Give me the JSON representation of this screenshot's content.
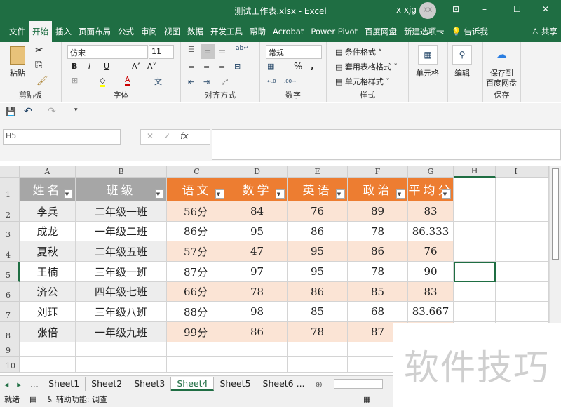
{
  "title": {
    "text": "测试工作表.xlsx  -  Excel",
    "user": "x xjg",
    "avatar": "XX",
    "ribbon_display": "⊡",
    "minimize": "–",
    "maximize": "☐",
    "close": "✕"
  },
  "menu": [
    "文件",
    "开始",
    "插入",
    "页面布局",
    "公式",
    "审阅",
    "视图",
    "数据",
    "开发工具",
    "帮助",
    "Acrobat",
    "Power Pivot",
    "百度网盘",
    "新建选项卡",
    "💡 告诉我",
    "♙ 共享"
  ],
  "menu_active": 1,
  "ribbon": {
    "clipboard": {
      "label": "剪贴板",
      "paste": "粘贴"
    },
    "font": {
      "label": "字体",
      "name": "仿宋",
      "size": "11",
      "bold": "B",
      "italic": "I",
      "underline": "U",
      "grow": "A˄",
      "shrink": "A˅",
      "color": "A",
      "fill": "◇",
      "wen": "文"
    },
    "align": {
      "label": "对齐方式",
      "wrap": "ab↵"
    },
    "number": {
      "label": "数字",
      "format": "常规",
      "pct": "%",
      "comma": ",",
      "inc": "←.0",
      "dec": ".00→"
    },
    "styles": {
      "label": "样式",
      "cond": "条件格式 ˅",
      "table": "套用表格格式 ˅",
      "cell": "单元格样式 ˅"
    },
    "cells": {
      "label": "单元格"
    },
    "edit": {
      "label": "编辑"
    },
    "save": {
      "label": "保存",
      "btn1": "保存到",
      "btn2": "百度网盘"
    }
  },
  "namebox": "H5",
  "fx": "fx",
  "columns": [
    "A",
    "B",
    "C",
    "D",
    "E",
    "F",
    "G",
    "H",
    "I"
  ],
  "rows": [
    "1",
    "2",
    "3",
    "4",
    "5",
    "6",
    "7",
    "8",
    "9",
    "10"
  ],
  "table": {
    "headers": [
      "姓名",
      "班级",
      "语文",
      "数学",
      "英语",
      "政治",
      "平均分"
    ],
    "data": [
      [
        "李兵",
        "二年级一班",
        "56分",
        "84",
        "76",
        "89",
        "83"
      ],
      [
        "成龙",
        "一年级二班",
        "86分",
        "95",
        "86",
        "78",
        "86.333"
      ],
      [
        "夏秋",
        "二年级五班",
        "57分",
        "47",
        "95",
        "86",
        "76"
      ],
      [
        "王楠",
        "三年级一班",
        "87分",
        "97",
        "95",
        "78",
        "90"
      ],
      [
        "济公",
        "四年级七班",
        "66分",
        "78",
        "86",
        "85",
        "83"
      ],
      [
        "刘珏",
        "三年级八班",
        "88分",
        "98",
        "85",
        "68",
        "83.667"
      ],
      [
        "张倍",
        "一年级九班",
        "99分",
        "86",
        "78",
        "87",
        ""
      ]
    ]
  },
  "colors": {
    "green": "#1f6e43",
    "gray_header": "#a6a6a6",
    "orange_header": "#ed7d31",
    "gray_band": "#ededed",
    "orange_band": "#fbe4d5"
  },
  "sheets": [
    "Sheet1",
    "Sheet2",
    "Sheet3",
    "Sheet4",
    "Sheet5",
    "Sheet6 ..."
  ],
  "active_sheet": 3,
  "status": {
    "ready": "就绪",
    "accessibility": "辅助功能: 调查"
  },
  "watermark": "软件技巧"
}
